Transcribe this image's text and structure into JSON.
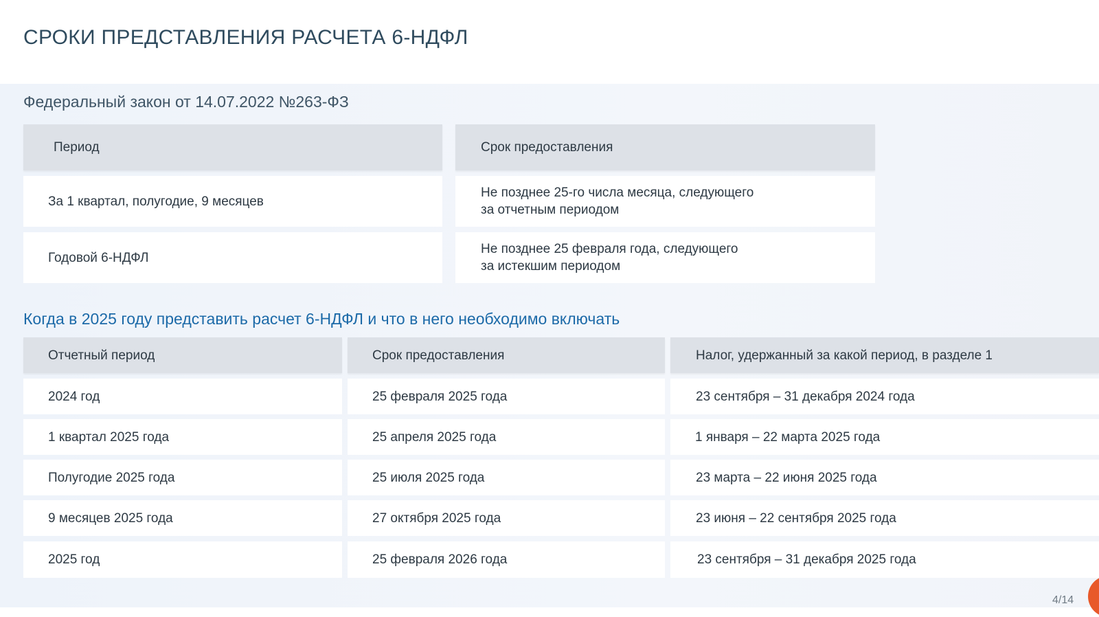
{
  "title": "СРОКИ ПРЕДСТАВЛЕНИЯ РАСЧЕТА 6-НДФЛ",
  "law": "Федеральный закон от 14.07.2022 №263-ФЗ",
  "table1": {
    "headers": [
      "Период",
      "Срок предоставления"
    ],
    "rows": [
      {
        "period": "За 1 квартал, полугодие, 9 месяцев",
        "deadline_line1": "Не позднее 25-го числа месяца, следующего",
        "deadline_line2": "за отчетным периодом"
      },
      {
        "period": "Годовой 6-НДФЛ",
        "deadline_line1": "Не позднее 25 февраля года, следующего",
        "deadline_line2": "за истекшим периодом"
      }
    ]
  },
  "subtitle": "Когда в 2025 году представить расчет 6-НДФЛ и что в него необходимо включать",
  "table2": {
    "headers": [
      "Отчетный период",
      "Срок предоставления",
      "Налог, удержанный за какой период, в разделе 1"
    ],
    "rows": [
      [
        "2024 год",
        "25 февраля 2025 года",
        "23 сентября – 31 декабря 2024 года"
      ],
      [
        "1 квартал 2025 года",
        "25 апреля 2025 года",
        "1 января – 22 марта 2025 года"
      ],
      [
        "Полугодие 2025 года",
        "25 июля 2025 года",
        "23 марта – 22 июня 2025 года"
      ],
      [
        "9 месяцев 2025 года",
        "27 октября 2025 года",
        "23 июня – 22 сентября 2025 года"
      ],
      [
        "2025 год",
        "25 февраля 2026 года",
        "23 сентября – 31 декабря 2025 года"
      ]
    ]
  },
  "page_number": "4/14",
  "colors": {
    "title": "#2f4b5e",
    "subtitle": "#1c6aa8",
    "header_cell": "#dde1e7",
    "accent": "#e8592a"
  }
}
